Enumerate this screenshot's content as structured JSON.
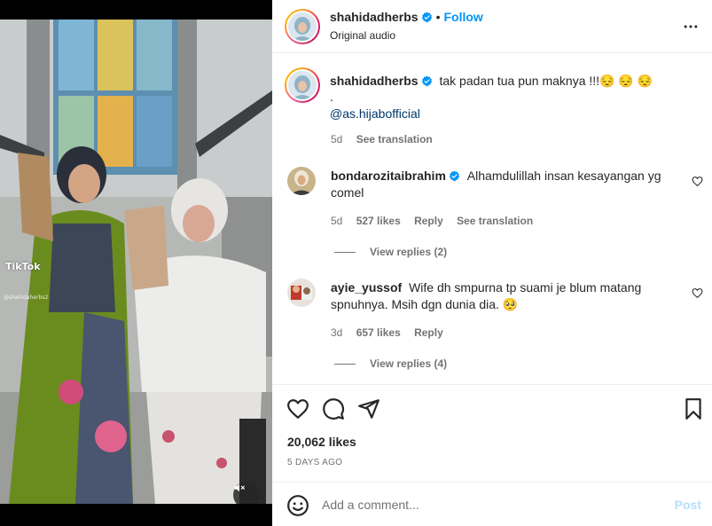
{
  "video": {
    "watermark_brand": "TikTok",
    "watermark_handle": "@shahidaherbs2",
    "mute_icon": "speaker-muted-icon"
  },
  "header": {
    "username": "shahidadherbs",
    "separator": "•",
    "follow_label": "Follow",
    "audio_label": "Original audio",
    "more_icon": "more-horizontal-icon"
  },
  "caption": {
    "username": "shahidadherbs",
    "text": "tak padan tua pun maknya !!!😔 😔 😔",
    "line2": ".",
    "mention": "@as.hijabofficial",
    "age": "5d",
    "see_translation": "See translation"
  },
  "comments": [
    {
      "username": "bondarozitaibrahim",
      "verified": true,
      "text": "Alhamdulillah insan kesayangan yg comel",
      "age": "5d",
      "likes": "527 likes",
      "reply": "Reply",
      "see_translation": "See translation",
      "view_replies": "View replies (2)"
    },
    {
      "username": "ayie_yussof",
      "verified": false,
      "text": "Wife dh smpurna tp suami je blum matang spnuhnya. Msih dgn dunia dia. 🥺",
      "age": "3d",
      "likes": "657 likes",
      "reply": "Reply",
      "view_replies": "View replies (4)"
    }
  ],
  "actions": {
    "likes": "20,062 likes",
    "date": "5 DAYS AGO"
  },
  "add_comment": {
    "placeholder": "Add a comment...",
    "post_label": "Post"
  },
  "colors": {
    "accent": "#0095f6",
    "verified": "#0095f6",
    "muted_text": "#737373",
    "post_disabled": "#b2dffc"
  }
}
